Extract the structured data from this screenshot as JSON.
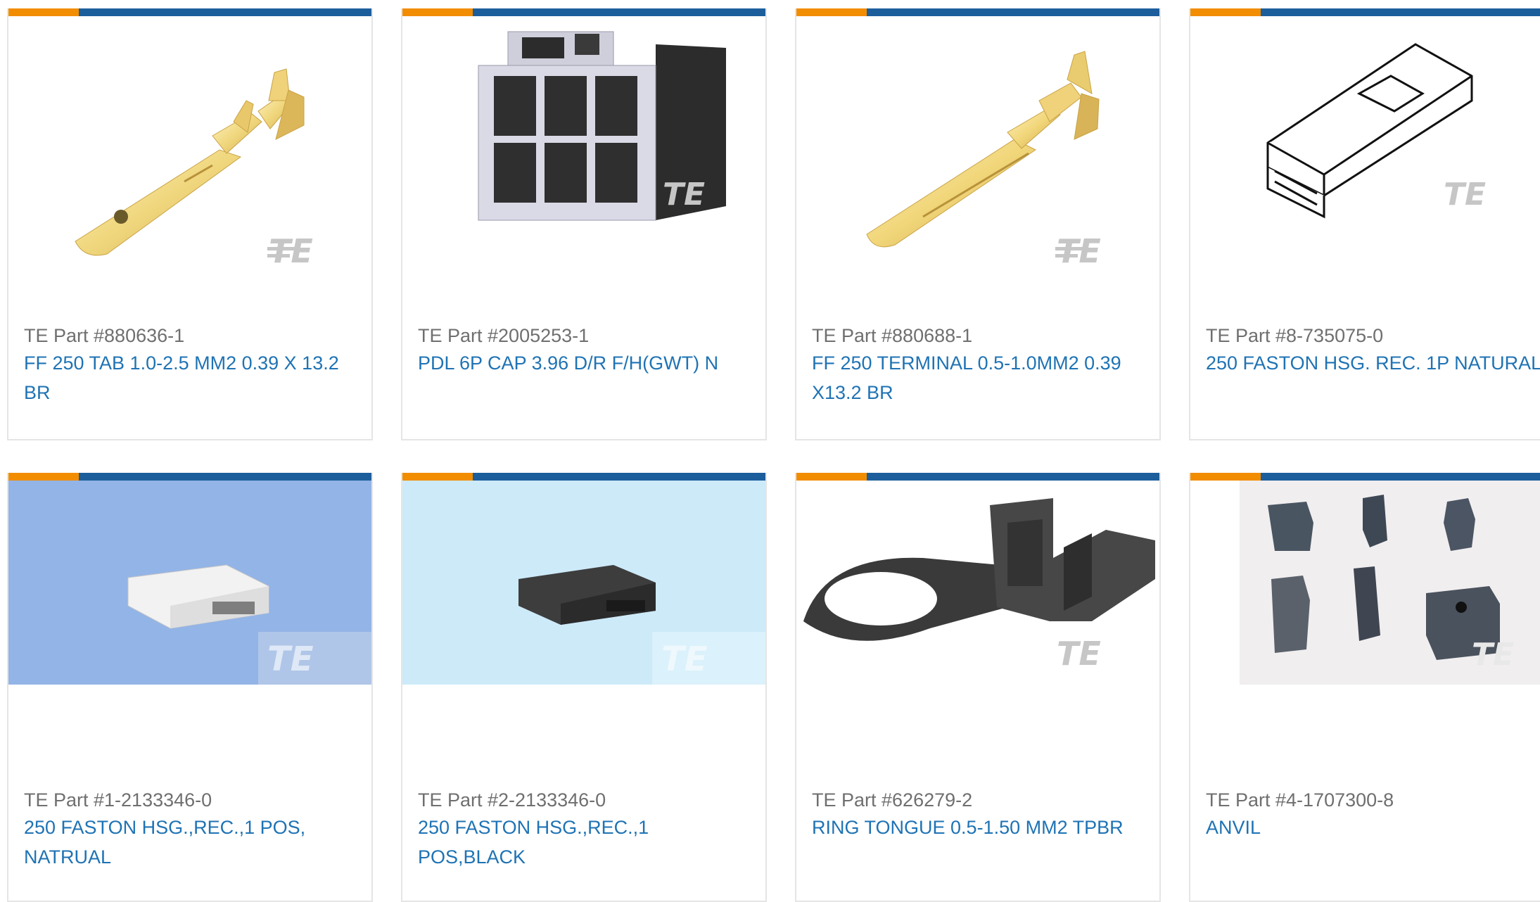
{
  "colors": {
    "accent_orange": "#f28d00",
    "accent_blue": "#1c5e9c",
    "link": "#1f73b4",
    "part_text": "#6f6f6f"
  },
  "watermark": "TE",
  "products": [
    {
      "part_number": "TE Part #880636-1",
      "description": "FF 250 TAB 1.0-2.5 MM2 0.39 X 13.2 BR",
      "image": "gold-tab-terminal"
    },
    {
      "part_number": "TE Part #2005253-1",
      "description": "PDL 6P CAP 3.96 D/R F/H(GWT) N",
      "image": "6-position-connector-housing"
    },
    {
      "part_number": "TE Part #880688-1",
      "description": "FF 250 TERMINAL 0.5-1.0MM2 0.39 X13.2 BR",
      "image": "gold-terminal"
    },
    {
      "part_number": "TE Part #8-735075-0",
      "description": "250 FASTON HSG. REC. 1P NATURAL",
      "image": "line-drawing-housing"
    },
    {
      "part_number": "TE Part #1-2133346-0",
      "description": "250 FASTON HSG.,REC.,1 POS, NATRUAL",
      "image": "white-housing-on-blue"
    },
    {
      "part_number": "TE Part #2-2133346-0",
      "description": "250 FASTON HSG.,REC.,1 POS,BLACK",
      "image": "black-housing-on-light-blue"
    },
    {
      "part_number": "TE Part #626279-2",
      "description": "RING TONGUE 0.5-1.50 MM2 TPBR",
      "image": "ring-tongue-terminal"
    },
    {
      "part_number": "TE Part #4-1707300-8",
      "description": "ANVIL",
      "image": "anvil-photo"
    }
  ]
}
